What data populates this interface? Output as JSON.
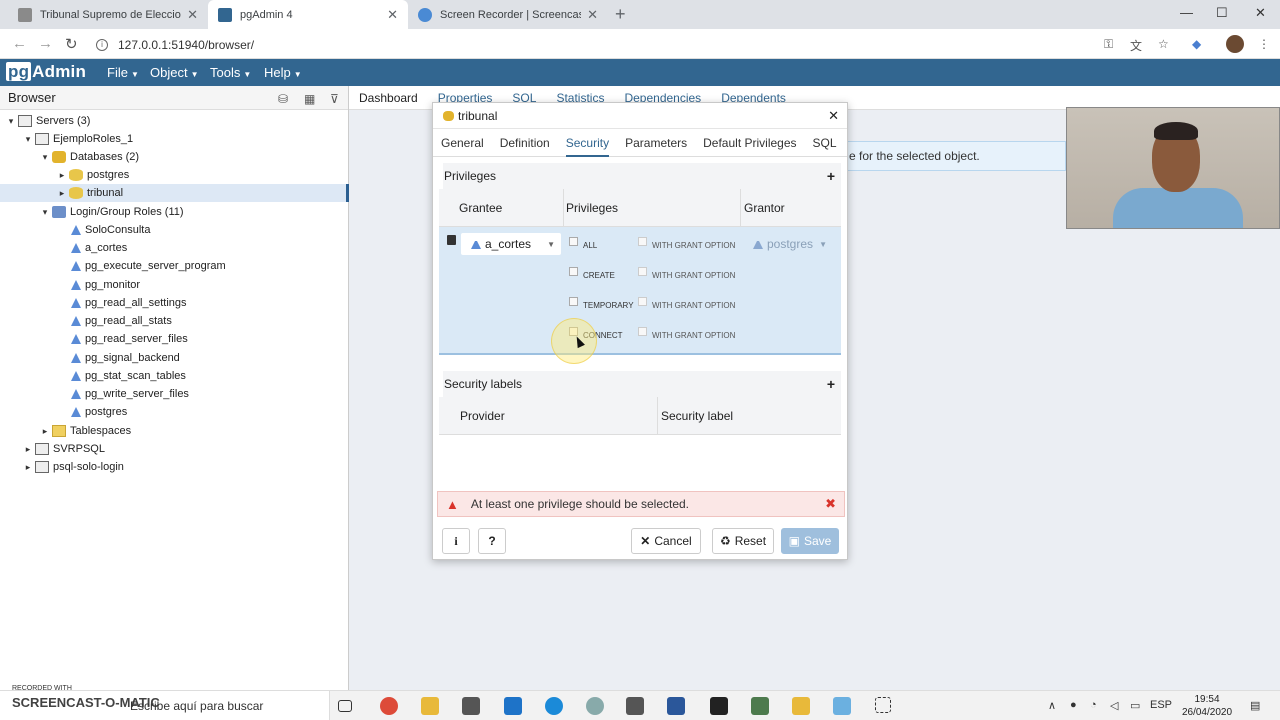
{
  "chrome": {
    "tabs": [
      {
        "title": "Tribunal Supremo de Elecciones,",
        "favicon_color": "#8a8a8a"
      },
      {
        "title": "pgAdmin 4",
        "favicon_color": "#326690"
      },
      {
        "title": "Screen Recorder | Screencast-O-",
        "favicon_color": "#4a8ad4"
      }
    ],
    "url": "127.0.0.1:51940/browser/"
  },
  "pgadmin": {
    "logo_prefix": "pg",
    "logo_suffix": "Admin",
    "menus": [
      "File",
      "Object",
      "Tools",
      "Help"
    ],
    "browser_title": "Browser",
    "tree": [
      {
        "label": "Servers (3)",
        "depth": 0,
        "arrow": "▾",
        "icon": "server"
      },
      {
        "label": "EjemploRoles_1",
        "depth": 1,
        "arrow": "▾",
        "icon": "server"
      },
      {
        "label": "Databases (2)",
        "depth": 2,
        "arrow": "▾",
        "icon": "dbgroup"
      },
      {
        "label": "postgres",
        "depth": 3,
        "arrow": "▸",
        "icon": "db"
      },
      {
        "label": "tribunal",
        "depth": 3,
        "arrow": "▸",
        "icon": "db",
        "selected": true
      },
      {
        "label": "Login/Group Roles (11)",
        "depth": 2,
        "arrow": "▾",
        "icon": "group"
      },
      {
        "label": "SoloConsulta",
        "depth": 3,
        "arrow": "",
        "icon": "role"
      },
      {
        "label": "a_cortes",
        "depth": 3,
        "arrow": "",
        "icon": "role"
      },
      {
        "label": "pg_execute_server_program",
        "depth": 3,
        "arrow": "",
        "icon": "role"
      },
      {
        "label": "pg_monitor",
        "depth": 3,
        "arrow": "",
        "icon": "role"
      },
      {
        "label": "pg_read_all_settings",
        "depth": 3,
        "arrow": "",
        "icon": "role"
      },
      {
        "label": "pg_read_all_stats",
        "depth": 3,
        "arrow": "",
        "icon": "role"
      },
      {
        "label": "pg_read_server_files",
        "depth": 3,
        "arrow": "",
        "icon": "role"
      },
      {
        "label": "pg_signal_backend",
        "depth": 3,
        "arrow": "",
        "icon": "role"
      },
      {
        "label": "pg_stat_scan_tables",
        "depth": 3,
        "arrow": "",
        "icon": "role"
      },
      {
        "label": "pg_write_server_files",
        "depth": 3,
        "arrow": "",
        "icon": "role"
      },
      {
        "label": "postgres",
        "depth": 3,
        "arrow": "",
        "icon": "role"
      },
      {
        "label": "Tablespaces",
        "depth": 2,
        "arrow": "▸",
        "icon": "ts"
      },
      {
        "label": "SVRPSQL",
        "depth": 1,
        "arrow": "▸",
        "icon": "srvx"
      },
      {
        "label": "psql-solo-login",
        "depth": 1,
        "arrow": "▸",
        "icon": "srvx"
      }
    ],
    "main_tabs": [
      "Dashboard",
      "Properties",
      "SQL",
      "Statistics",
      "Dependencies",
      "Dependents"
    ],
    "info_text": "e for the selected object."
  },
  "dialog": {
    "title": "tribunal",
    "tabs": [
      "General",
      "Definition",
      "Security",
      "Parameters",
      "Default Privileges",
      "SQL"
    ],
    "active_tab": "Security",
    "privileges_section": "Privileges",
    "columns": [
      "Grantee",
      "Privileges",
      "Grantor"
    ],
    "grantee": "a_cortes",
    "grantor": "postgres",
    "privileges": [
      "ALL",
      "CREATE",
      "TEMPORARY",
      "CONNECT"
    ],
    "grant_option_label": "WITH GRANT OPTION",
    "security_labels_section": "Security labels",
    "label_columns": [
      "Provider",
      "Security label"
    ],
    "alert": "At least one privilege should be selected.",
    "buttons": {
      "info": "i",
      "help": "?",
      "cancel": "Cancel",
      "reset": "Reset",
      "save": "Save"
    }
  },
  "taskbar": {
    "search_placeholder": "Escribe aquí para buscar",
    "watermark_small": "RECORDED WITH",
    "watermark": "SCREENCAST-O-MATIC",
    "lang": "ESP",
    "time": "19:54",
    "date": "26/04/2020"
  }
}
